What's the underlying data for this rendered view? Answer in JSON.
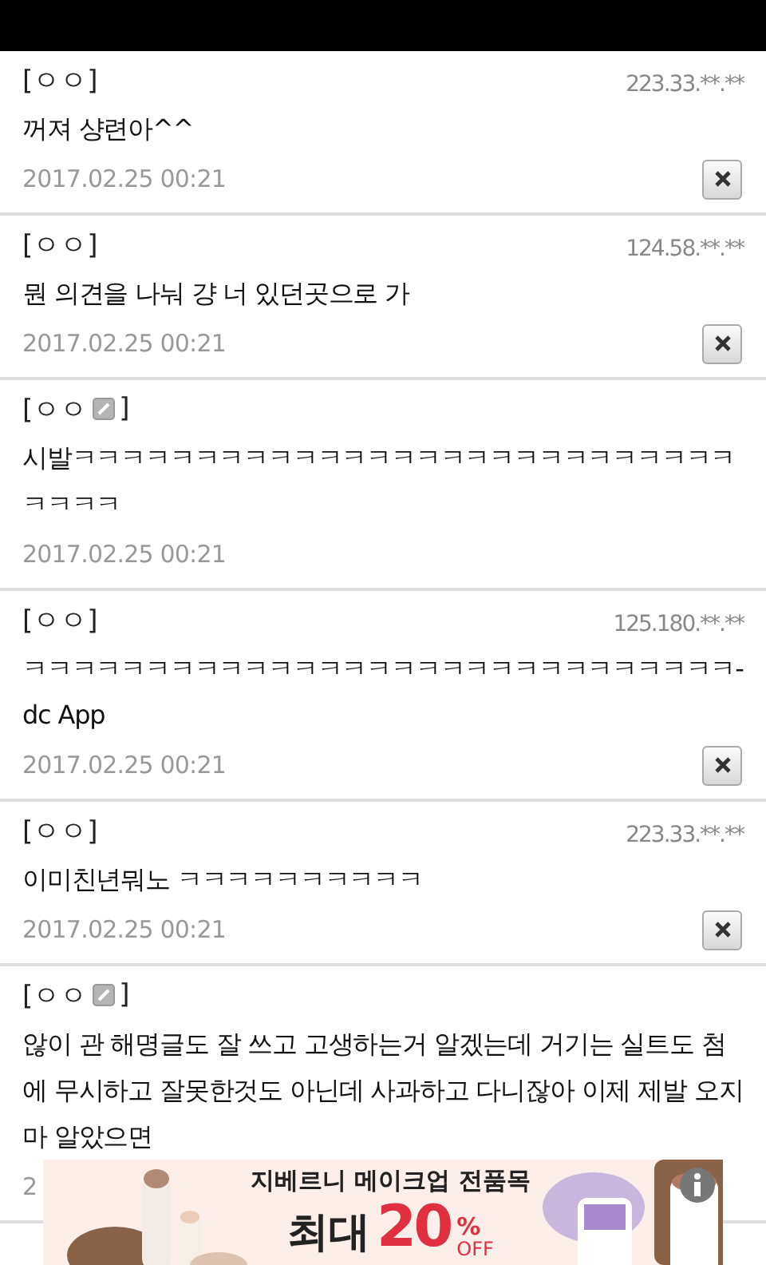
{
  "comments": [
    {
      "name_open": "[ㅇㅇ]",
      "badge": false,
      "ip": "223.33.**.**",
      "body": "꺼져 샹련아^^",
      "date": "2017.02.25 00:21",
      "deletable": true
    },
    {
      "name_open": "[ㅇㅇ]",
      "badge": false,
      "ip": "124.58.**.**",
      "body": "뭔 의견을 나눠 걍 너 있던곳으로 가",
      "date": "2017.02.25 00:21",
      "deletable": true
    },
    {
      "name_open": "[ㅇㅇ",
      "badge": true,
      "name_close": "]",
      "body": "시발ㅋㅋㅋㅋㅋㅋㅋㅋㅋㅋㅋㅋㅋㅋㅋㅋㅋㅋㅋㅋㅋㅋㅋㅋㅋㅋㅋㅋㅋㅋㅋ",
      "date": "2017.02.25 00:21",
      "deletable": false
    },
    {
      "name_open": "[ㅇㅇ]",
      "badge": false,
      "ip": "125.180.**.**",
      "body": "ㅋㅋㅋㅋㅋㅋㅋㅋㅋㅋㅋㅋㅋㅋㅋㅋㅋㅋㅋㅋㅋㅋㅋㅋㅋㅋㅋㅋㅋ-dc App",
      "date": "2017.02.25 00:21",
      "deletable": true
    },
    {
      "name_open": "[ㅇㅇ]",
      "badge": false,
      "ip": "223.33.**.**",
      "body": "이미친년뭐노 ㅋㅋㅋㅋㅋㅋㅋㅋㅋㅋ",
      "date": "2017.02.25 00:21",
      "deletable": true
    },
    {
      "name_open": "[ㅇㅇ",
      "badge": true,
      "name_close": "]",
      "body": "않이 관 해명글도 잘 쓰고 고생하는거 알겠는데 거기는 실트도 첨에 무시하고 잘못한것도 아닌데 사과하고 다니잖아 이제 제발 오지마 알았으면",
      "date": "2",
      "deletable": false
    }
  ],
  "ad": {
    "headline": "지베르니 메이크업 전품목",
    "prefix": "최대",
    "number": "20",
    "percent": "%",
    "off": "OFF"
  }
}
